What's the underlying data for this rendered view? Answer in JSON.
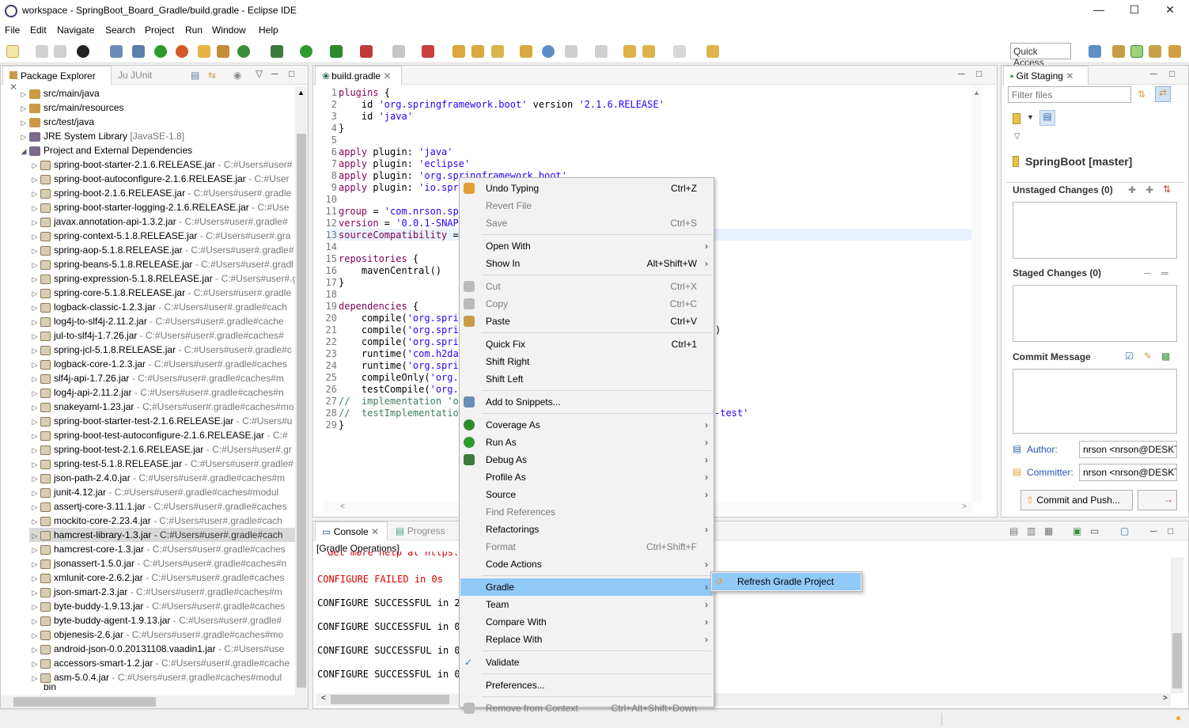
{
  "window": {
    "title": "workspace - SpringBoot_Board_Gradle/build.gradle - Eclipse IDE"
  },
  "menu": [
    "File",
    "Edit",
    "Navigate",
    "Search",
    "Project",
    "Run",
    "Window",
    "Help"
  ],
  "quick_access": "Quick Access",
  "package_explorer": {
    "tabs": [
      "Package Explorer",
      "JUnit"
    ],
    "roots": [
      {
        "label": "src/main/java"
      },
      {
        "label": "src/main/resources"
      },
      {
        "label": "src/test/java"
      },
      {
        "label": "JRE System Library",
        "extra": "[JavaSE-1.8]"
      },
      {
        "label": "Project and External Dependencies"
      }
    ],
    "jars": [
      {
        "name": "spring-boot-starter-2.1.6.RELEASE.jar",
        "path": "- C:#Users#user#"
      },
      {
        "name": "spring-boot-autoconfigure-2.1.6.RELEASE.jar",
        "path": "- C:#User"
      },
      {
        "name": "spring-boot-2.1.6.RELEASE.jar",
        "path": "- C:#Users#user#.gradle"
      },
      {
        "name": "spring-boot-starter-logging-2.1.6.RELEASE.jar",
        "path": "- C:#Use"
      },
      {
        "name": "javax.annotation-api-1.3.2.jar",
        "path": "- C:#Users#user#.gradle#"
      },
      {
        "name": "spring-context-5.1.8.RELEASE.jar",
        "path": "- C:#Users#user#.gra"
      },
      {
        "name": "spring-aop-5.1.8.RELEASE.jar",
        "path": "- C:#Users#user#.gradle#"
      },
      {
        "name": "spring-beans-5.1.8.RELEASE.jar",
        "path": "- C:#Users#user#.gradl"
      },
      {
        "name": "spring-expression-5.1.8.RELEASE.jar",
        "path": "- C:#Users#user#.g"
      },
      {
        "name": "spring-core-5.1.8.RELEASE.jar",
        "path": "- C:#Users#user#.gradle"
      },
      {
        "name": "logback-classic-1.2.3.jar",
        "path": "- C:#Users#user#.gradle#cach"
      },
      {
        "name": "log4j-to-slf4j-2.11.2.jar",
        "path": "- C:#Users#user#.gradle#cache"
      },
      {
        "name": "jul-to-slf4j-1.7.26.jar",
        "path": "- C:#Users#user#.gradle#caches#"
      },
      {
        "name": "spring-jcl-5.1.8.RELEASE.jar",
        "path": "- C:#Users#user#.gradle#c"
      },
      {
        "name": "logback-core-1.2.3.jar",
        "path": "- C:#Users#user#.gradle#caches"
      },
      {
        "name": "slf4j-api-1.7.26.jar",
        "path": "- C:#Users#user#.gradle#caches#m"
      },
      {
        "name": "log4j-api-2.11.2.jar",
        "path": "- C:#Users#user#.gradle#caches#n"
      },
      {
        "name": "snakeyaml-1.23.jar",
        "path": "- C:#Users#user#.gradle#caches#mo"
      },
      {
        "name": "spring-boot-starter-test-2.1.6.RELEASE.jar",
        "path": "- C:#Users#u"
      },
      {
        "name": "spring-boot-test-autoconfigure-2.1.6.RELEASE.jar",
        "path": "- C:#"
      },
      {
        "name": "spring-boot-test-2.1.6.RELEASE.jar",
        "path": "- C:#Users#user#.gr"
      },
      {
        "name": "spring-test-5.1.8.RELEASE.jar",
        "path": "- C:#Users#user#.gradle#"
      },
      {
        "name": "json-path-2.4.0.jar",
        "path": "- C:#Users#user#.gradle#caches#m"
      },
      {
        "name": "junit-4.12.jar",
        "path": "- C:#Users#user#.gradle#caches#modul"
      },
      {
        "name": "assertj-core-3.11.1.jar",
        "path": "- C:#Users#user#.gradle#caches"
      },
      {
        "name": "mockito-core-2.23.4.jar",
        "path": "- C:#Users#user#.gradle#cach"
      },
      {
        "name": "hamcrest-library-1.3.jar",
        "path": "- C:#Users#user#.gradle#cach"
      },
      {
        "name": "hamcrest-core-1.3.jar",
        "path": "- C:#Users#user#.gradle#caches"
      },
      {
        "name": "jsonassert-1.5.0.jar",
        "path": "- C:#Users#user#.gradle#caches#n"
      },
      {
        "name": "xmlunit-core-2.6.2.jar",
        "path": "- C:#Users#user#.gradle#caches"
      },
      {
        "name": "json-smart-2.3.jar",
        "path": "- C:#Users#user#.gradle#caches#m"
      },
      {
        "name": "byte-buddy-1.9.13.jar",
        "path": "- C:#Users#user#.gradle#caches"
      },
      {
        "name": "byte-buddy-agent-1.9.13.jar",
        "path": "- C:#Users#user#.gradle#"
      },
      {
        "name": "objenesis-2.6.jar",
        "path": "- C:#Users#user#.gradle#caches#mo"
      },
      {
        "name": "android-json-0.0.20131108.vaadin1.jar",
        "path": "- C:#Users#use"
      },
      {
        "name": "accessors-smart-1.2.jar",
        "path": "- C:#Users#user#.gradle#cache"
      },
      {
        "name": "asm-5.0.4.jar",
        "path": "- C:#Users#user#.gradle#caches#modul"
      }
    ],
    "bottom_partial": "bin"
  },
  "editor": {
    "tab": "build.gradle",
    "lines": [
      {
        "n": "1",
        "t": "plugins {"
      },
      {
        "n": "2",
        "t": "    id 'org.springframework.boot' version '2.1.6.RELEASE'"
      },
      {
        "n": "3",
        "t": "    id 'java'"
      },
      {
        "n": "4",
        "t": "}"
      },
      {
        "n": "5",
        "t": ""
      },
      {
        "n": "6",
        "t": "apply plugin: 'java'"
      },
      {
        "n": "7",
        "t": "apply plugin: 'eclipse'"
      },
      {
        "n": "8",
        "t": "apply plugin: 'org.springframework.boot'"
      },
      {
        "n": "9",
        "t": "apply plugin: 'io.spri"
      },
      {
        "n": "10",
        "t": ""
      },
      {
        "n": "11",
        "t": "group = 'com.nrson.spr"
      },
      {
        "n": "12",
        "t": "version = '0.0.1-SNAPS"
      },
      {
        "n": "13",
        "t": "sourceCompatibility = "
      },
      {
        "n": "14",
        "t": ""
      },
      {
        "n": "15",
        "t": "repositories {"
      },
      {
        "n": "16",
        "t": "    mavenCentral()"
      },
      {
        "n": "17",
        "t": "}"
      },
      {
        "n": "18",
        "t": ""
      },
      {
        "n": "19",
        "t": "dependencies {"
      },
      {
        "n": "20",
        "t": "    compile('org.sprin"
      },
      {
        "n": "21",
        "t": "    compile('org.sprin"
      },
      {
        "n": "22",
        "t": "    compile('org.sprin"
      },
      {
        "n": "23",
        "t": "    runtime('com.h2dat"
      },
      {
        "n": "24",
        "t": "    runtime('org.sprin"
      },
      {
        "n": "25",
        "t": "    compileOnly('org.p"
      },
      {
        "n": "26",
        "t": "    testCompile('org.s"
      },
      {
        "n": "27",
        "t": "//  implementation 'or"
      },
      {
        "n": "28",
        "t": "//  testImplementation"
      },
      {
        "n": "29",
        "t": "}"
      }
    ],
    "overflow_right": {
      "line21": ")",
      "line28": "-test'"
    }
  },
  "context_menu": {
    "items": [
      {
        "label": "Undo Typing",
        "shortcut": "Ctrl+Z",
        "enabled": true
      },
      {
        "label": "Revert File",
        "shortcut": "",
        "enabled": false
      },
      {
        "label": "Save",
        "shortcut": "Ctrl+S",
        "enabled": false
      },
      {
        "label": "Open With",
        "shortcut": "",
        "enabled": true,
        "sub": true
      },
      {
        "label": "Show In",
        "shortcut": "Alt+Shift+W",
        "enabled": true,
        "sub": true
      },
      {
        "label": "Cut",
        "shortcut": "Ctrl+X",
        "enabled": false
      },
      {
        "label": "Copy",
        "shortcut": "Ctrl+C",
        "enabled": false
      },
      {
        "label": "Paste",
        "shortcut": "Ctrl+V",
        "enabled": true
      },
      {
        "label": "Quick Fix",
        "shortcut": "Ctrl+1",
        "enabled": true
      },
      {
        "label": "Shift Right",
        "shortcut": "",
        "enabled": true
      },
      {
        "label": "Shift Left",
        "shortcut": "",
        "enabled": true
      },
      {
        "label": "Add to Snippets...",
        "shortcut": "",
        "enabled": true
      },
      {
        "label": "Coverage As",
        "shortcut": "",
        "enabled": true,
        "sub": true
      },
      {
        "label": "Run As",
        "shortcut": "",
        "enabled": true,
        "sub": true
      },
      {
        "label": "Debug As",
        "shortcut": "",
        "enabled": true,
        "sub": true
      },
      {
        "label": "Profile As",
        "shortcut": "",
        "enabled": true,
        "sub": true
      },
      {
        "label": "Source",
        "shortcut": "",
        "enabled": true,
        "sub": true
      },
      {
        "label": "Find References",
        "shortcut": "",
        "enabled": false
      },
      {
        "label": "Refactorings",
        "shortcut": "",
        "enabled": true,
        "sub": true
      },
      {
        "label": "Format",
        "shortcut": "Ctrl+Shift+F",
        "enabled": false
      },
      {
        "label": "Code Actions",
        "shortcut": "",
        "enabled": true,
        "sub": true
      },
      {
        "label": "Gradle",
        "shortcut": "",
        "enabled": true,
        "sub": true,
        "selected": true
      },
      {
        "label": "Team",
        "shortcut": "",
        "enabled": true,
        "sub": true
      },
      {
        "label": "Compare With",
        "shortcut": "",
        "enabled": true,
        "sub": true
      },
      {
        "label": "Replace With",
        "shortcut": "",
        "enabled": true,
        "sub": true
      },
      {
        "label": "Validate",
        "shortcut": "",
        "enabled": true,
        "checked": true
      },
      {
        "label": "Preferences...",
        "shortcut": "",
        "enabled": true
      },
      {
        "label": "Remove from Context",
        "shortcut": "Ctrl+Alt+Shift+Down",
        "enabled": false
      }
    ],
    "submenu": {
      "label": "Refresh Gradle Project"
    }
  },
  "console": {
    "tabs": [
      "Console",
      "Progress"
    ],
    "header": "[Gradle Operations]",
    "top_partial": "Get more help at https:",
    "lines": [
      {
        "t": "CONFIGURE FAILED in 0s",
        "color": "#d90000"
      },
      {
        "t": "CONFIGURE SUCCESSFUL in 2:",
        "color": "#000000"
      },
      {
        "t": "CONFIGURE SUCCESSFUL in 0s",
        "color": "#000000"
      },
      {
        "t": "CONFIGURE SUCCESSFUL in 0s",
        "color": "#000000"
      },
      {
        "t": "CONFIGURE SUCCESSFUL in 0s",
        "color": "#000000"
      }
    ]
  },
  "git": {
    "tab": "Git Staging",
    "filter_placeholder": "Filter files",
    "repo": "SpringBoot [master]",
    "unstaged": "Unstaged Changes (0)",
    "staged": "Staged Changes (0)",
    "commit_message": "Commit Message",
    "author_label": "Author:",
    "author_value": "nrson <nrson@DESKT",
    "committer_label": "Committer:",
    "committer_value": "nrson <nrson@DESKT",
    "commit_push": "Commit and Push..."
  },
  "colors": {
    "selection": "#91c9f7",
    "keyword": "#7f0055",
    "string": "#2a00ff",
    "comment": "#3f7f5f",
    "error": "#d90000"
  }
}
